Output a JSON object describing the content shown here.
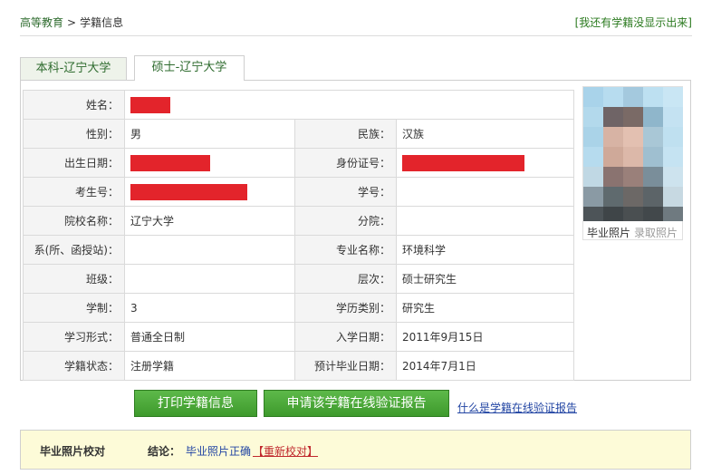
{
  "breadcrumb": {
    "home": "高等教育",
    "separator": ">",
    "current": "学籍信息"
  },
  "missing_link": "[我还有学籍没显示出来]",
  "tabs": [
    {
      "label": "本科-辽宁大学",
      "active": false
    },
    {
      "label": "硕士-辽宁大学",
      "active": true
    }
  ],
  "fields": {
    "name": {
      "label": "姓名：",
      "value": ""
    },
    "gender": {
      "label": "性别：",
      "value": "男"
    },
    "ethnicity": {
      "label": "民族：",
      "value": "汉族"
    },
    "birthdate": {
      "label": "出生日期：",
      "value": ""
    },
    "id_number": {
      "label": "身份证号：",
      "value": ""
    },
    "exam_number": {
      "label": "考生号：",
      "value": ""
    },
    "student_number": {
      "label": "学号：",
      "value": ""
    },
    "school": {
      "label": "院校名称：",
      "value": "辽宁大学"
    },
    "branch": {
      "label": "分院：",
      "value": ""
    },
    "department": {
      "label": "系(所、函授站)：",
      "value": ""
    },
    "major": {
      "label": "专业名称：",
      "value": "环境科学"
    },
    "class": {
      "label": "班级：",
      "value": ""
    },
    "level": {
      "label": "层次：",
      "value": "硕士研究生"
    },
    "duration": {
      "label": "学制：",
      "value": "3"
    },
    "degree_type": {
      "label": "学历类别：",
      "value": "研究生"
    },
    "study_form": {
      "label": "学习形式：",
      "value": "普通全日制"
    },
    "enroll_date": {
      "label": "入学日期：",
      "value": "2011年9月15日"
    },
    "status": {
      "label": "学籍状态：",
      "value": "注册学籍"
    },
    "grad_date": {
      "label": "预计毕业日期：",
      "value": "2014年7月1日"
    }
  },
  "photo": {
    "caption": "毕业照片",
    "recapture": "录取照片"
  },
  "buttons": {
    "print": "打印学籍信息",
    "apply": "申请该学籍在线验证报告"
  },
  "what_link": "什么是学籍在线验证报告",
  "verify": {
    "title": "毕业照片校对",
    "conclusion_label": "结论：",
    "result": "毕业照片正确",
    "recheck": "【重新校对】"
  },
  "colors": {
    "accent_green": "#3e9a2c",
    "redaction": "#e3242b",
    "link_blue": "#2245a3",
    "status_red": "#c0282d",
    "notice_bg": "#fdfbd8"
  }
}
